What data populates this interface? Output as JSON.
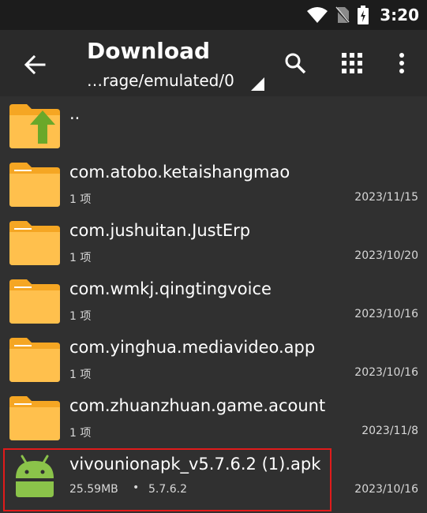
{
  "status_bar": {
    "time": "3:20",
    "icons": [
      "wifi-icon",
      "no-sim-icon",
      "battery-icon"
    ]
  },
  "app_bar": {
    "title": "Download",
    "path": "…rage/emulated/0",
    "actions": [
      "search-icon",
      "grid-view-icon",
      "more-vert-icon"
    ]
  },
  "files": [
    {
      "name": "..",
      "type": "parent-folder"
    },
    {
      "name": "com.atobo.ketaishangmao",
      "meta": "1 项",
      "date": "2023/11/15",
      "type": "folder"
    },
    {
      "name": "com.jushuitan.JustErp",
      "meta": "1 项",
      "date": "2023/10/20",
      "type": "folder"
    },
    {
      "name": "com.wmkj.qingtingvoice",
      "meta": "1 项",
      "date": "2023/10/16",
      "type": "folder"
    },
    {
      "name": "com.yinghua.mediavideo.app",
      "meta": "1 项",
      "date": "2023/10/16",
      "type": "folder"
    },
    {
      "name": "com.zhuanzhuan.game.acount",
      "meta": "1 项",
      "date": "2023/11/8",
      "type": "folder"
    },
    {
      "name": "vivounionapk_v5.7.6.2 (1).apk",
      "meta": "25.59MB",
      "separator": "•",
      "version": "5.7.6.2",
      "date": "2023/10/16",
      "type": "apk"
    }
  ],
  "colors": {
    "folder": "#F5A623",
    "folder_light": "#FFC04D",
    "apk": "#8BC34A",
    "highlight": "#E01B1B"
  }
}
